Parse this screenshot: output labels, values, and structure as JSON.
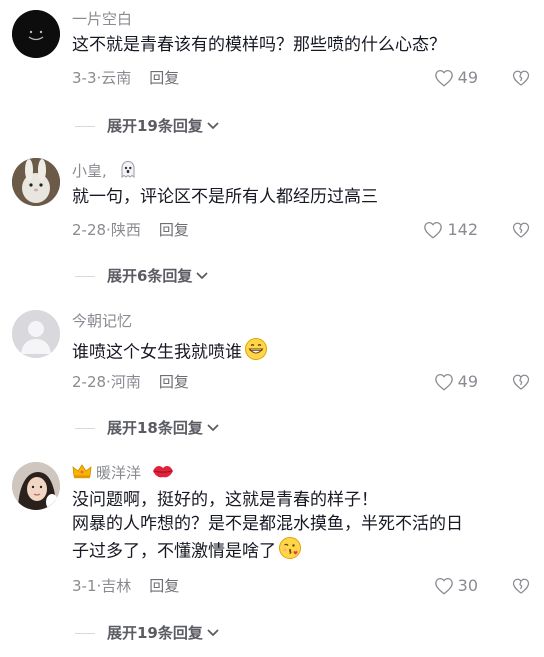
{
  "comments": [
    {
      "username": "一片空白",
      "text_lines": [
        "这不就是青春该有的模样吗？那些喷的什么心态？"
      ],
      "date": "3-3",
      "location": "云南",
      "reply_label": "回复",
      "likes": "49",
      "expand_label": "展开19条回复"
    },
    {
      "username": "小皇,",
      "text_lines": [
        "就一句，评论区不是所有人都经历过高三"
      ],
      "date": "2-28",
      "location": "陕西",
      "reply_label": "回复",
      "likes": "142",
      "expand_label": "展开6条回复"
    },
    {
      "username": "今朝记忆",
      "text_lines": [
        "谁喷这个女生我就喷谁"
      ],
      "date": "2-28",
      "location": "河南",
      "reply_label": "回复",
      "likes": "49",
      "expand_label": "展开18条回复"
    },
    {
      "username": "暖洋洋",
      "text_lines": [
        "没问题啊，挺好的，这就是青春的样子！",
        "网暴的人咋想的？是不是都混水摸鱼，半死不活的日",
        "子过多了，不懂激情是啥了"
      ],
      "date": "3-1",
      "location": "吉林",
      "reply_label": "回复",
      "likes": "30",
      "expand_label": "展开19条回复"
    }
  ],
  "colors": {
    "text_primary": "#161823",
    "text_secondary": "#8a8b91",
    "divider": "#d9d9dc"
  },
  "icons": [
    "smiley-avatar-icon",
    "ghost-badge-icon",
    "crown-icon",
    "lips-badge-icon",
    "grin-emoji-icon",
    "kiss-emoji-icon",
    "heart-icon",
    "broken-heart-icon",
    "chevron-down-icon"
  ]
}
